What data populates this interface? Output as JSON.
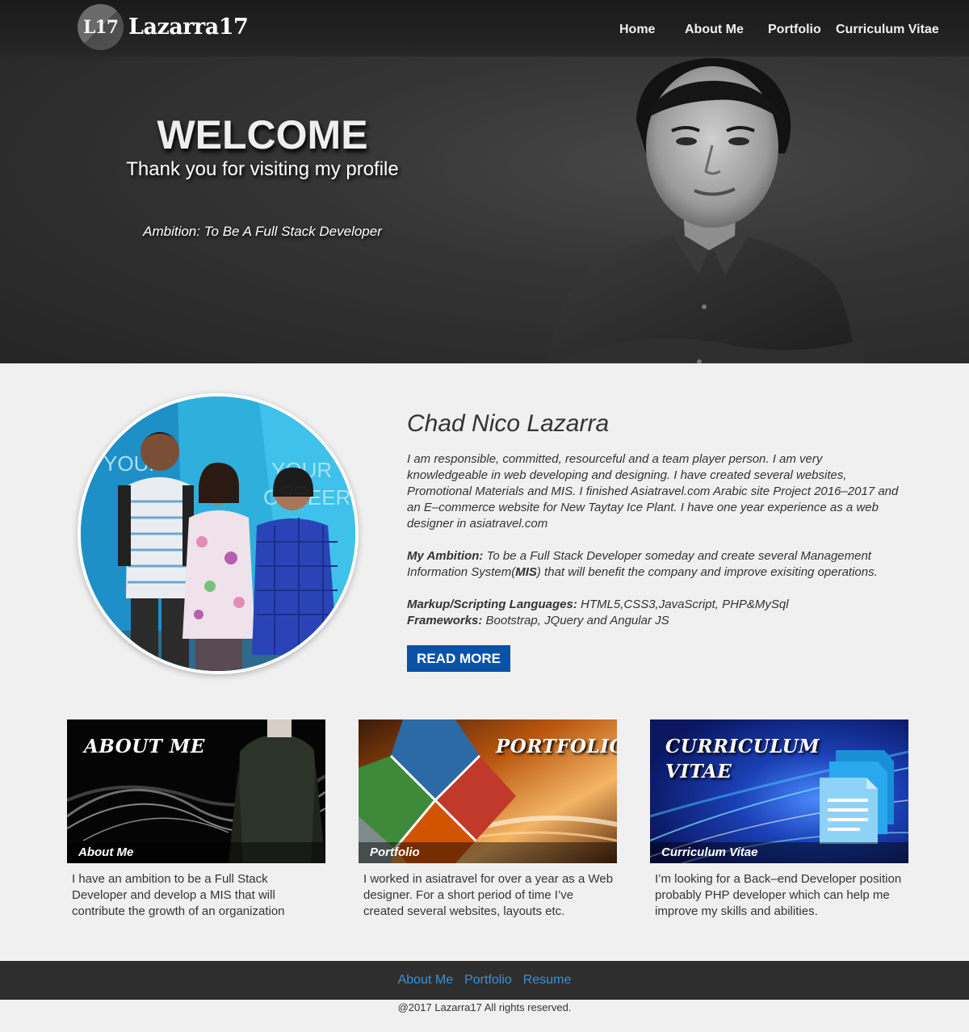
{
  "header": {
    "logo_badge": "L17",
    "logo_text": "Lazarra17",
    "nav": [
      "Home",
      "About Me",
      "Portfolio",
      "Curriculum Vitae"
    ]
  },
  "hero": {
    "title": "WELCOME",
    "subtitle": "Thank you for visiting my profile",
    "ambition": "Ambition: To Be A Full Stack Developer"
  },
  "profile": {
    "name": "Chad Nico Lazarra",
    "bio": "I am responsible, committed, resourceful and a team player person.  I am very knowledgeable in web developing and designing.  I have created several websites, Promotional Materials and MIS.  I finished Asiatravel.com Arabic site Project 2016–2017 and an E–commerce website for New Taytay Ice Plant.  I have one year experience as a web designer in asiatravel.com",
    "ambition_label": "My Ambition:",
    "ambition_text_1": " To be a Full Stack Developer someday and create several Management Information System(",
    "ambition_mis": "MIS",
    "ambition_text_2": ") that will benefit the company and improve exisiting operations.",
    "languages_label": "Markup/Scripting Languages:",
    "languages": " HTML5,CSS3,JavaScript, PHP&MySql",
    "frameworks_label": "Frameworks:",
    "frameworks": " Bootstrap, JQuery and Angular JS",
    "read_more": "READ MORE",
    "photo_sign_text_1": "YOUR",
    "photo_sign_text_2": "CAREER"
  },
  "cards": [
    {
      "title": "ABOUT ME",
      "caption": "About Me",
      "text": "I have an ambition to be a Full Stack Developer and develop a MIS that will contribute the growth of an organization"
    },
    {
      "title": "PORTFOLIO",
      "caption": "Portfolio",
      "text": "I worked in asiatravel for over a year as a Web designer.  For a short period of time I’ve created several websites, layouts etc."
    },
    {
      "title_line1": "CURRICULUM",
      "title_line2": "VITAE",
      "caption": "Curriculum Vitae",
      "text": "I’m looking for a Back–end Developer position probably PHP developer which can help me improve my skills and abilities."
    }
  ],
  "footer": {
    "links": [
      "About Me",
      "Portfolio",
      "Resume"
    ],
    "copyright": "@2017 Lazarra17 All rights  reserved."
  },
  "colors": {
    "accent": "#0a52a8",
    "footer_link": "#3b8fd6",
    "header_bg": "#1f1f1f"
  }
}
